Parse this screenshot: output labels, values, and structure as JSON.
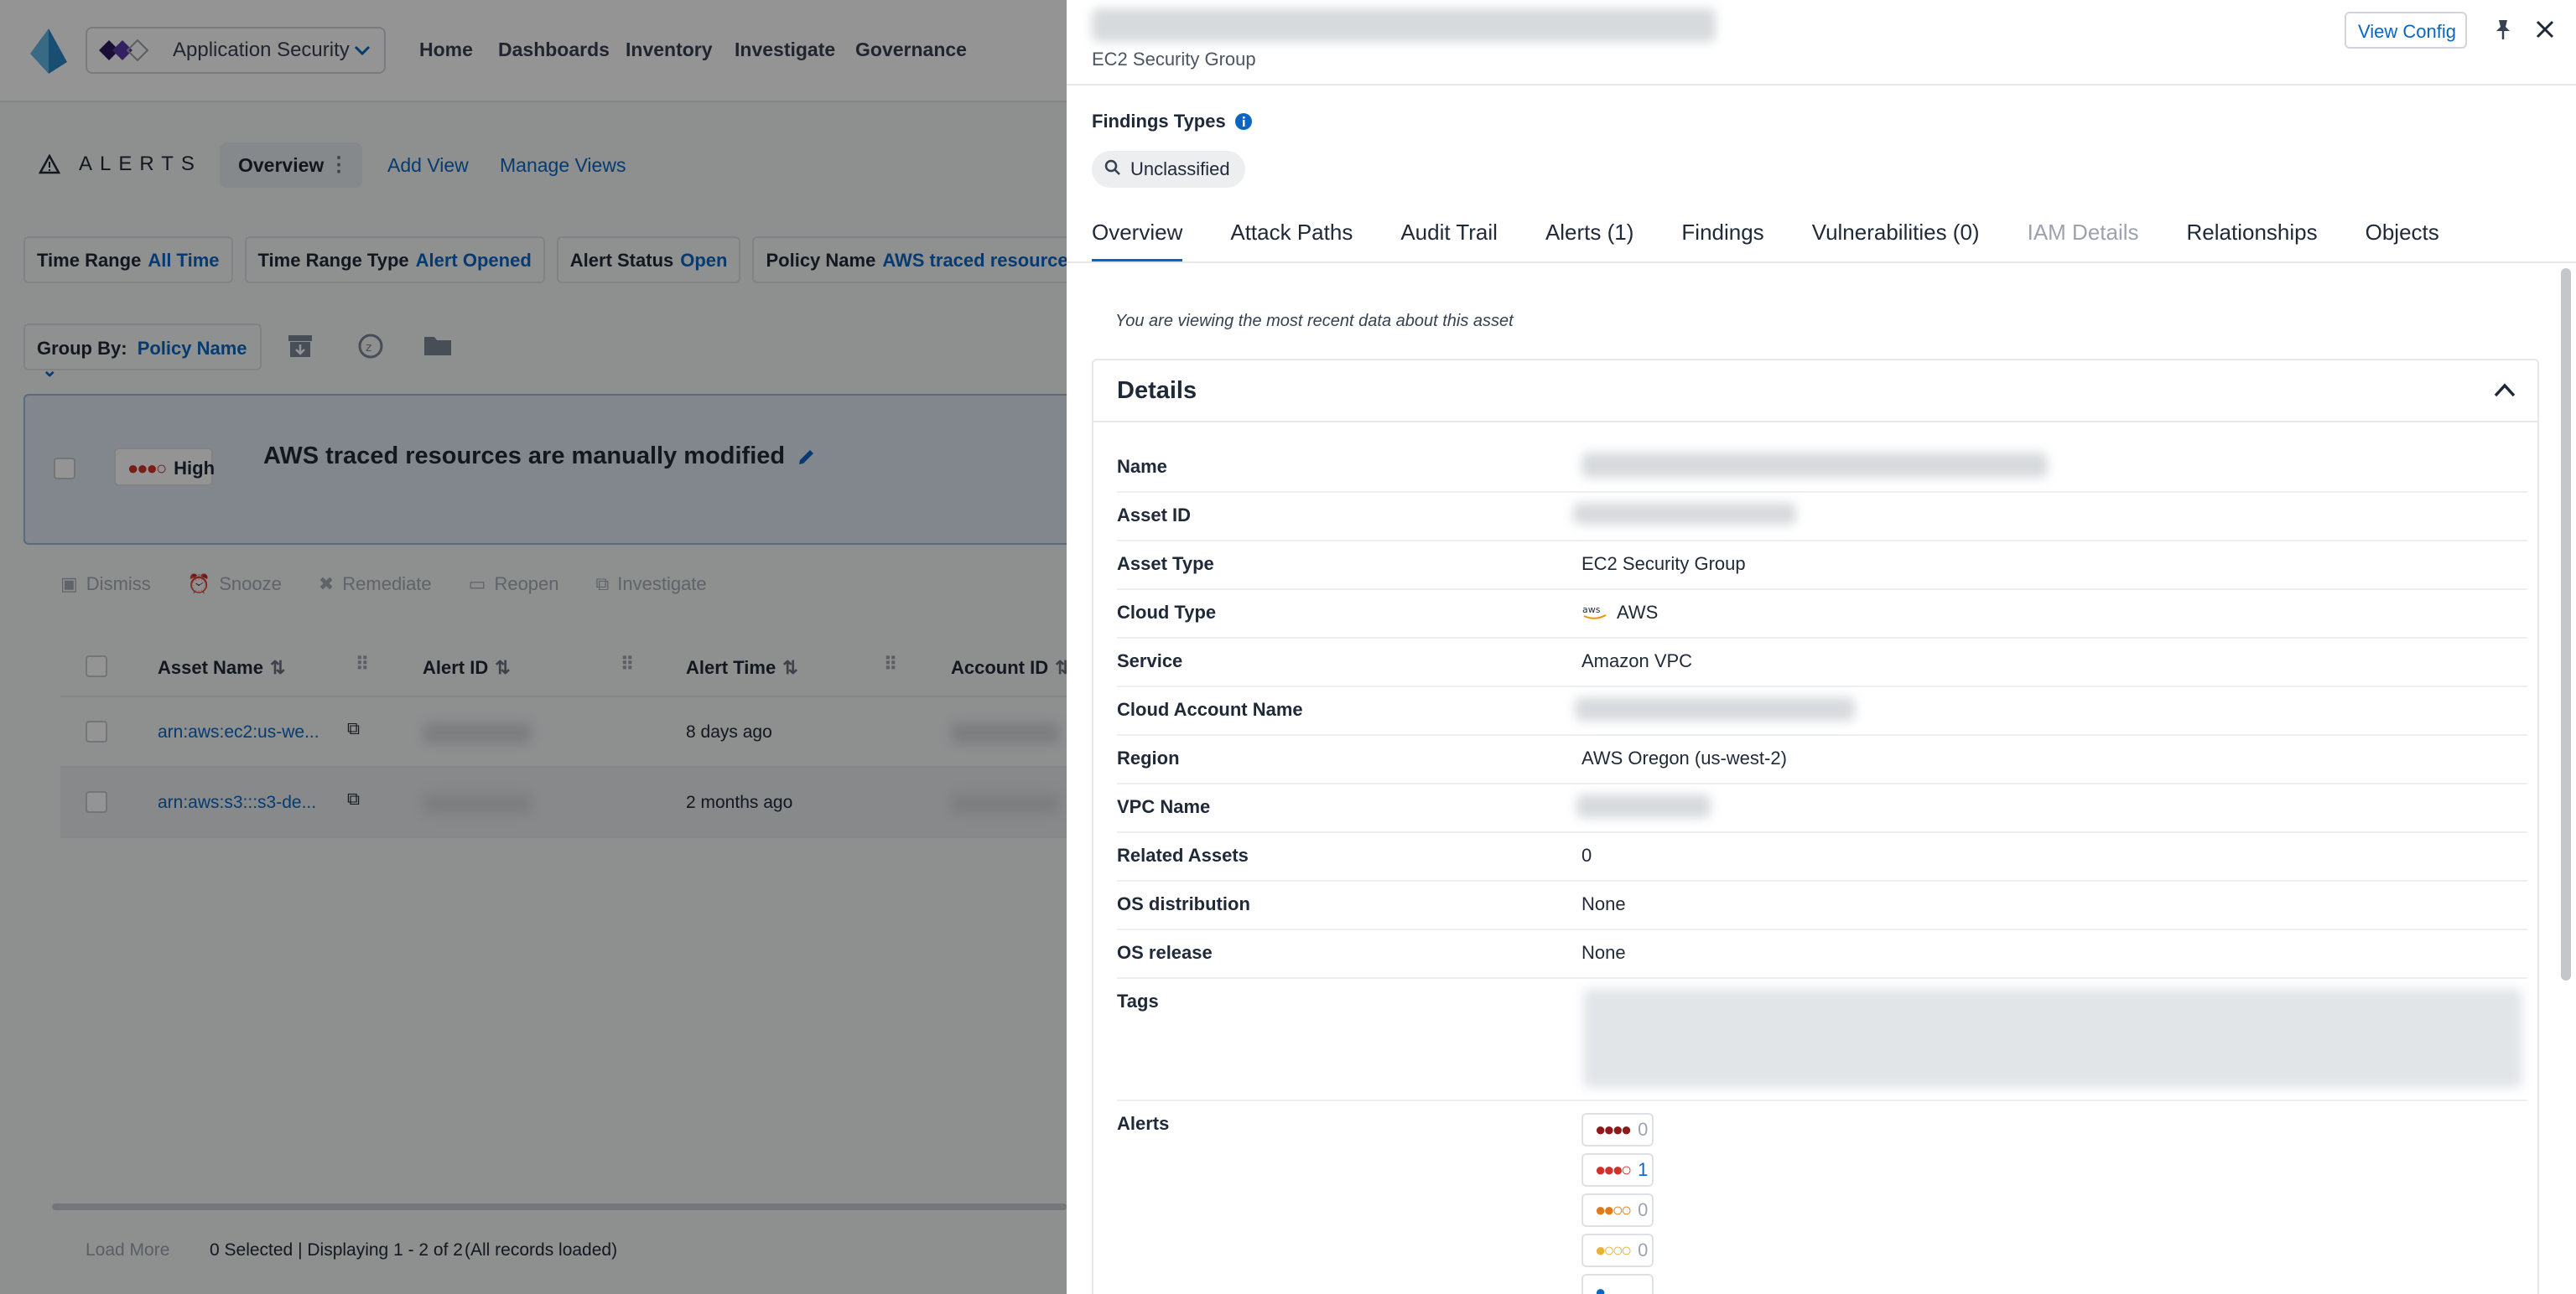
{
  "nav": {
    "app_name": "Application Security",
    "links": [
      "Home",
      "Dashboards",
      "Inventory",
      "Investigate",
      "Governance"
    ]
  },
  "alerts_page": {
    "title": "ALERTS",
    "active_view": "Overview",
    "add_view": "Add View",
    "manage_views": "Manage Views",
    "filters": [
      {
        "label": "Time Range",
        "value": "All Time"
      },
      {
        "label": "Time Range Type",
        "value": "Alert Opened"
      },
      {
        "label": "Alert Status",
        "value": "Open"
      },
      {
        "label": "Policy Name",
        "value": "AWS traced resources ar"
      }
    ],
    "group_by_label": "Group By:",
    "group_by_value": "Policy Name",
    "group": {
      "severity": "High",
      "policy_title": "AWS traced resources are manually modified"
    },
    "actions": [
      "Dismiss",
      "Snooze",
      "Remediate",
      "Reopen",
      "Investigate"
    ],
    "columns": [
      "Asset Name",
      "Alert ID",
      "Alert Time",
      "Account ID"
    ],
    "rows": [
      {
        "asset_name": "arn:aws:ec2:us-we...",
        "alert_time": "8 days ago"
      },
      {
        "asset_name": "arn:aws:s3:::s3-de...",
        "alert_time": "2 months ago"
      }
    ],
    "footer": {
      "load_more": "Load More",
      "status": "0 Selected | Displaying 1 - 2 of 2",
      "loaded": "(All records loaded)"
    }
  },
  "drawer": {
    "subtitle": "EC2 Security Group",
    "view_config": "View Config",
    "findings_types_label": "Findings Types",
    "findings_pill": "Unclassified",
    "tabs": [
      {
        "label": "Overview",
        "state": "active"
      },
      {
        "label": "Attack Paths",
        "state": "normal"
      },
      {
        "label": "Audit Trail",
        "state": "normal"
      },
      {
        "label": "Alerts (1)",
        "state": "normal"
      },
      {
        "label": "Findings",
        "state": "normal"
      },
      {
        "label": "Vulnerabilities (0)",
        "state": "normal"
      },
      {
        "label": "IAM Details",
        "state": "disabled"
      },
      {
        "label": "Relationships",
        "state": "normal"
      },
      {
        "label": "Objects",
        "state": "normal"
      }
    ],
    "note": "You are viewing the most recent data about this asset",
    "details_title": "Details",
    "details": {
      "name_label": "Name",
      "asset_id_label": "Asset ID",
      "asset_type_label": "Asset Type",
      "asset_type": "EC2 Security Group",
      "cloud_type_label": "Cloud Type",
      "cloud_type": "AWS",
      "service_label": "Service",
      "service": "Amazon VPC",
      "cloud_account_label": "Cloud Account Name",
      "region_label": "Region",
      "region": "AWS Oregon (us-west-2)",
      "vpc_label": "VPC Name",
      "related_label": "Related Assets",
      "related": "0",
      "os_dist_label": "OS distribution",
      "os_dist": "None",
      "os_release_label": "OS release",
      "os_release": "None",
      "tags_label": "Tags",
      "alerts_label": "Alerts"
    },
    "alert_counts": [
      {
        "level": "critical",
        "count": "0"
      },
      {
        "level": "high",
        "count": "1"
      },
      {
        "level": "medium",
        "count": "0"
      },
      {
        "level": "low",
        "count": "0"
      }
    ]
  },
  "colors": {
    "accent": "#0b66c3",
    "critical": "#8b1a1a",
    "high": "#d0312d",
    "medium": "#e07b1a",
    "low": "#e8b23a"
  }
}
